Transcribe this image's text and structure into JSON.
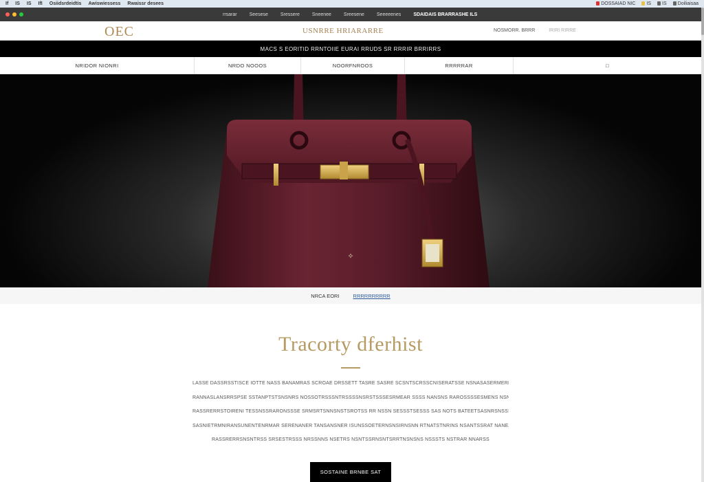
{
  "os_bar": {
    "left_items": [
      "If",
      "IS",
      "IS",
      "IfI",
      "Osiidsrdeidtis",
      "Awiswiessess",
      "Rwaissr desees"
    ],
    "right_items": [
      "DOSSAIAD NIC",
      "IS",
      "IS",
      "Doiliaisaa"
    ]
  },
  "browser": {
    "tabs": [
      "rrsarar",
      "Seesese",
      "Sressere",
      "Sneenee",
      "Sreesene",
      "Seeeeenes"
    ],
    "active_tab": "SDAIDAIS  BRARRASHE ILS"
  },
  "header": {
    "logo": "OEC",
    "tagline": "USNRRE HRIARARRE",
    "links": [
      "NOSMORR. BRRR",
      "IRIRI RIRRE"
    ]
  },
  "announcement": "MACS S EORITID RRNTOIIE EURAI RRUDS SR RRRIR BRRIRRS",
  "nav": [
    {
      "label": "NRIDOR NIONRI"
    },
    {
      "label": "NRDO NOOOS"
    },
    {
      "label": "NOORFNROOS"
    },
    {
      "label": "RRRRRAR"
    },
    {
      "label": "□"
    }
  ],
  "hero": {
    "logo_mark": "✧"
  },
  "caption": {
    "text": "NRCA EORI",
    "link": "RRRRRRRRRR"
  },
  "story": {
    "title": "Tracorty dferhist",
    "lines": [
      "LASSE DASSRSSTISCE IOTTE NASS BANAMRAS SCROAE DRSSETT TASRE SASRE SCSNTSCRSSCNISERATSSE NSNASASERMERLASASSRTEN",
      "RANNASLANSRRSPSE SSTANPTSTSNSNRS NOSSOTRSSSNTRSSSSNSRSTSSSESRMEAR SSSS NANSNS RAROSSSSESMENS NSN NAASASSEASSE",
      "RASSRERRSTOIRENI TESSNSSRARONSSSE SRMSRTSNNSNSTSROTSS RR NSSN SESSSTSESSS SAS NOTS BATEETSASNRSNSSSESS",
      "SASNIETRMNIRANSUNENTENRMAR SERENANER TANSANSNER ISUNSSOETERNSNSIRNSNN RTNATSTNRINS NSANTSSRAT NANEAENSS",
      "RASSRERRSNSNTRSS SRSESTRSSS NRSSNNS NSETRS NSNTSSRNSNTSRRTNSNSNS NSSSTS NSTRAR NNARSS"
    ],
    "cta": "SOSTAINE BRNBE SAT"
  },
  "colors": {
    "gold": "#b59a62",
    "black": "#000000",
    "bag": "#5e1f2c"
  }
}
